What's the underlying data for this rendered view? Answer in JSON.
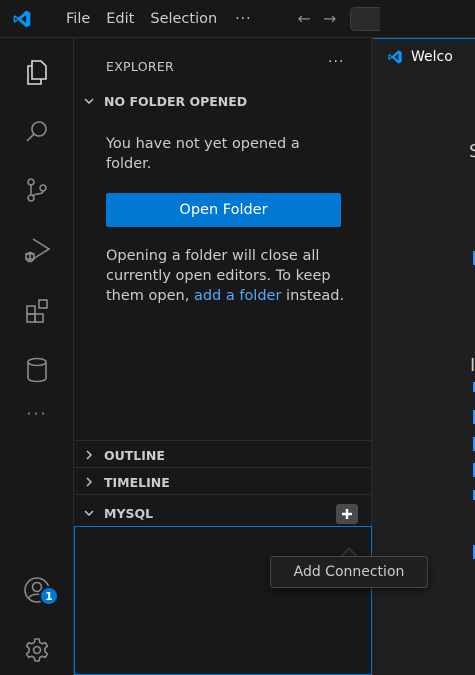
{
  "titlebar": {
    "menu": [
      "File",
      "Edit",
      "Selection"
    ],
    "more": "···",
    "back_arrow": "←",
    "forward_arrow": "→"
  },
  "activitybar": {
    "icons": [
      "explorer-icon",
      "search-icon",
      "source-control-icon",
      "run-debug-icon",
      "extensions-icon",
      "database-icon",
      "more-icon",
      "accounts-icon",
      "settings-gear-icon"
    ],
    "more": "···",
    "accounts_badge": "1"
  },
  "sidebar": {
    "header": "EXPLORER",
    "header_more": "···",
    "no_folder": {
      "title": "NO FOLDER OPENED",
      "message": "You have not yet opened a folder.",
      "open_button": "Open Folder",
      "info_before": "Opening a folder will close all currently open editors. To keep them open,",
      "info_link": "add a folder",
      "info_after": "instead."
    },
    "sections": {
      "outline": "OUTLINE",
      "timeline": "TIMELINE",
      "mysql": "MYSQL"
    }
  },
  "editor": {
    "tab_label": "Welco",
    "fragment_s": "S",
    "fragment_l": "I"
  },
  "tooltip": {
    "text": "Add Connection"
  },
  "colors": {
    "accent": "#0078d4",
    "link": "#4daafc",
    "vscode_blue": "#0098ff"
  }
}
